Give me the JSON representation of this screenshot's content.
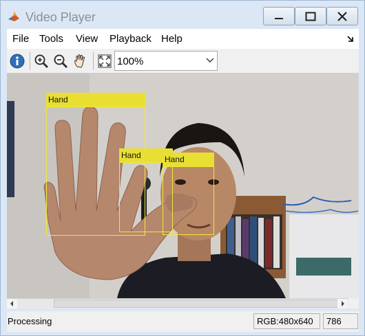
{
  "window": {
    "title": "Video Player"
  },
  "menu": {
    "file": "File",
    "tools": "Tools",
    "view": "View",
    "playback": "Playback",
    "help": "Help"
  },
  "toolbar": {
    "zoom_value": "100%",
    "icons": [
      "info-icon",
      "zoom-in-icon",
      "zoom-out-icon",
      "pan-hand-icon",
      "fit-to-window-icon"
    ]
  },
  "detections": [
    {
      "label": "Hand"
    },
    {
      "label": "Hand"
    },
    {
      "label": "Hand"
    }
  ],
  "colors": {
    "bbox_outline": "#f0e83a",
    "bbox_label_bg": "#e8df32"
  },
  "status": {
    "state": "Processing",
    "image_info": "RGB:480x640",
    "frame": "786"
  }
}
